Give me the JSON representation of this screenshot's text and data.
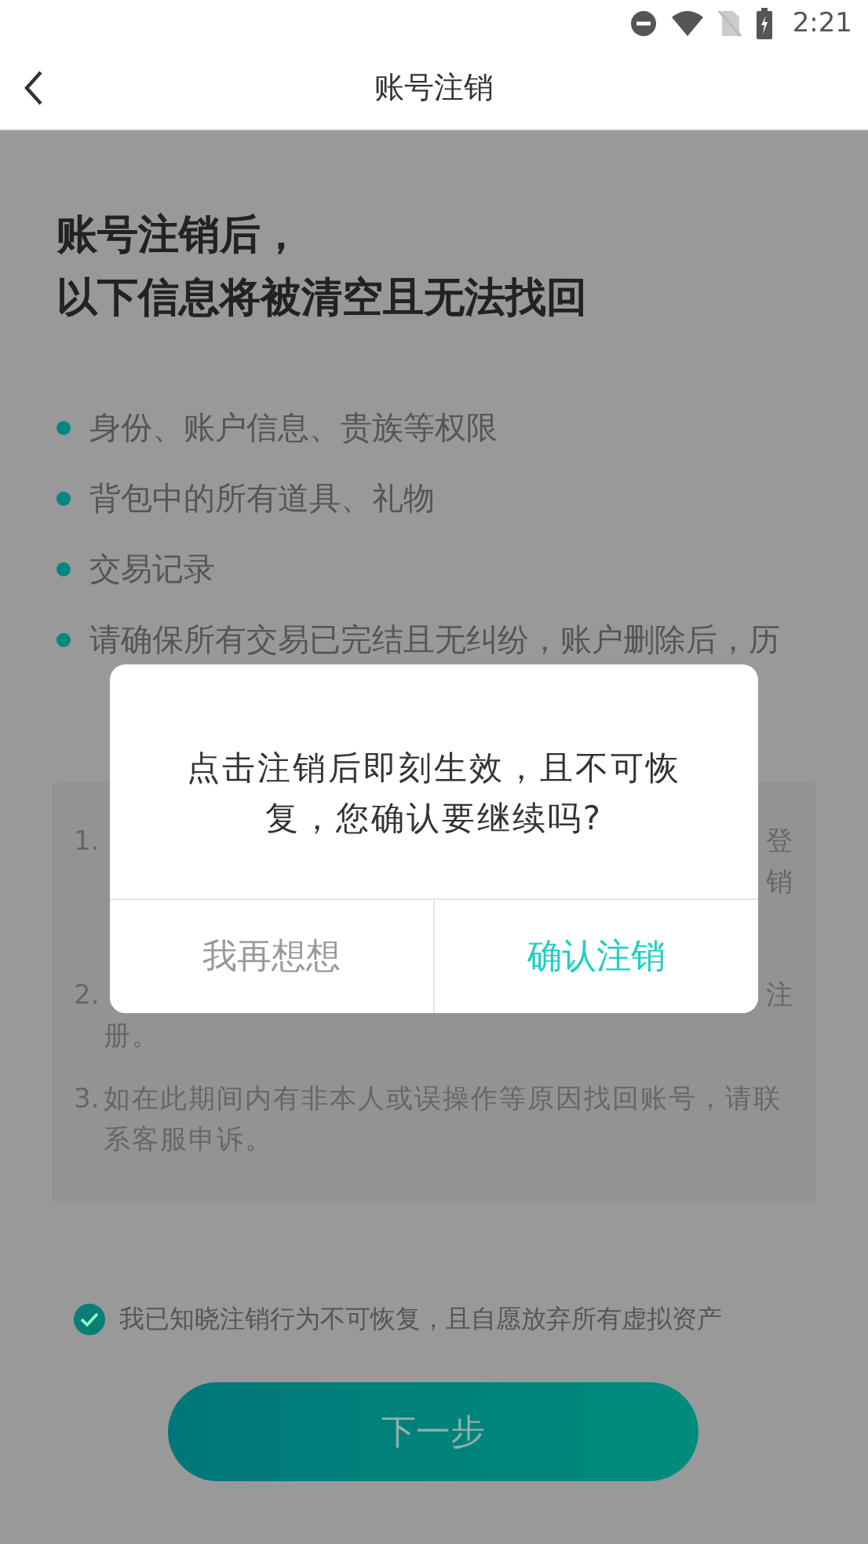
{
  "status_bar": {
    "time": "2:21"
  },
  "header": {
    "title": "账号注销"
  },
  "heading": [
    "账号注销后，",
    "以下信息将被清空且无法找回"
  ],
  "items": [
    "身份、账户信息、贵族等权限",
    "背包中的所有道具、礼物",
    "交易记录",
    "请确保所有交易已完结且无纠纷，账户删除后，历"
  ],
  "notes": [
    {
      "number": "1.",
      "right_fragments": [
        "登",
        "销"
      ]
    },
    {
      "number": "2.",
      "right_fragments": [
        "注"
      ],
      "text": "册。"
    },
    {
      "number": "3.",
      "text": "如在此期间内有非本人或误操作等原因找回账号，请联系客服申诉。"
    }
  ],
  "agreement": {
    "checked": true,
    "text": "我已知晓注销行为不可恢复，且自愿放弃所有虚拟资产"
  },
  "next_button": {
    "label": "下一步"
  },
  "dialog": {
    "message": "点击注销后即刻生效，且不可恢复，您确认要继续吗?",
    "buttons": [
      {
        "label": "我再想想",
        "kind": "cancel"
      },
      {
        "label": "确认注销",
        "kind": "confirm"
      }
    ]
  }
}
